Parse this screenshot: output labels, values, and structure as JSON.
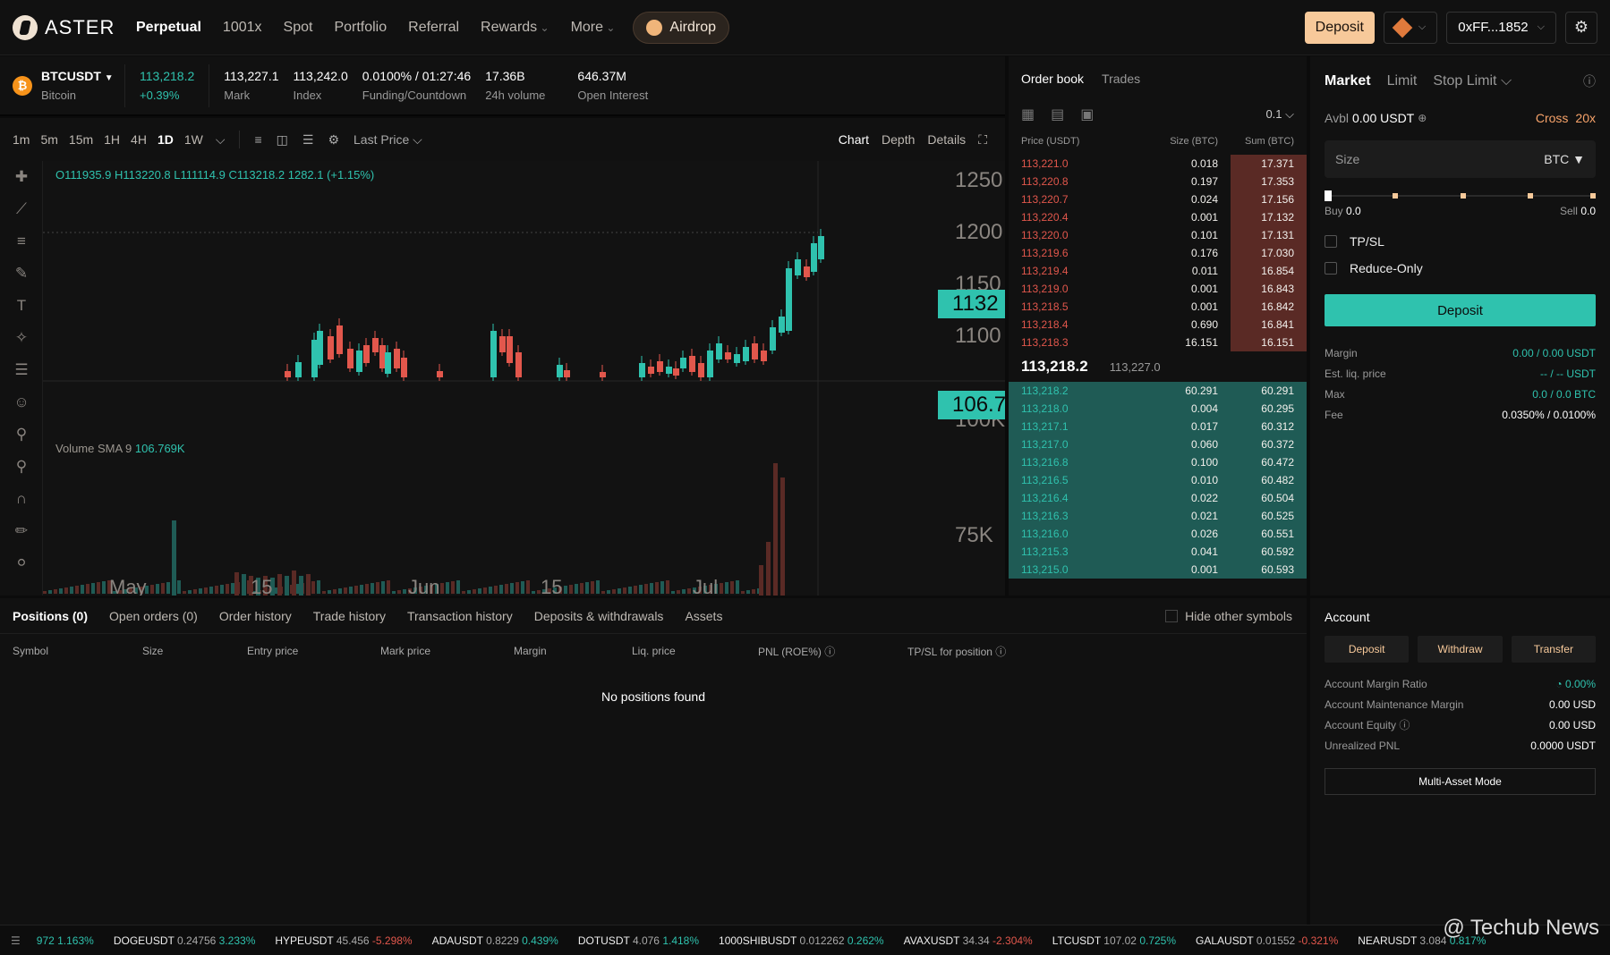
{
  "brand": {
    "name": "ASTER"
  },
  "nav": {
    "items": [
      "Perpetual",
      "1001x",
      "Spot",
      "Portfolio",
      "Referral",
      "Rewards",
      "More"
    ],
    "airdrop": "Airdrop",
    "deposit": "Deposit",
    "wallet": "0xFF...1852"
  },
  "ticker": {
    "symbol": "BTCUSDT",
    "name": "Bitcoin",
    "last": "113,218.2",
    "change": "+0.39%",
    "mark": "113,227.1",
    "mark_label": "Mark",
    "index": "113,242.0",
    "index_label": "Index",
    "funding": "0.0100% / 01:27:46",
    "funding_label": "Funding/Countdown",
    "volume": "17.36B",
    "volume_label": "24h volume",
    "oi": "646.37M",
    "oi_label": "Open Interest"
  },
  "chart_toolbar": {
    "timeframes": [
      "1m",
      "5m",
      "15m",
      "1H",
      "4H",
      "1D",
      "1W"
    ],
    "active": "1D",
    "price_type": "Last Price",
    "views": [
      "Chart",
      "Depth",
      "Details"
    ]
  },
  "chart_data": {
    "type": "candlestick",
    "ohlc": "O111935.9 H113220.8 L111114.9 C113218.2 1282.1 (+1.15%)",
    "volume_label": "Volume SMA 9",
    "volume_value": "106.769K",
    "price_axis": [
      "1250",
      "1200",
      "1150",
      "1100"
    ],
    "current_tag": "1132",
    "volume_axis": [
      "100K",
      "75K"
    ],
    "volume_tag": "106.7",
    "x_labels": [
      "May",
      "15",
      "Jun",
      "15",
      "Jul"
    ]
  },
  "orderbook": {
    "tabs": [
      "Order book",
      "Trades"
    ],
    "step": "0.1",
    "headers": [
      "Price (USDT)",
      "Size (BTC)",
      "Sum (BTC)"
    ],
    "asks": [
      [
        "113,221.0",
        "0.018",
        "17.371"
      ],
      [
        "113,220.8",
        "0.197",
        "17.353"
      ],
      [
        "113,220.7",
        "0.024",
        "17.156"
      ],
      [
        "113,220.4",
        "0.001",
        "17.132"
      ],
      [
        "113,220.0",
        "0.101",
        "17.131"
      ],
      [
        "113,219.6",
        "0.176",
        "17.030"
      ],
      [
        "113,219.4",
        "0.011",
        "16.854"
      ],
      [
        "113,219.0",
        "0.001",
        "16.843"
      ],
      [
        "113,218.5",
        "0.001",
        "16.842"
      ],
      [
        "113,218.4",
        "0.690",
        "16.841"
      ],
      [
        "113,218.3",
        "16.151",
        "16.151"
      ]
    ],
    "mid_price": "113,218.2",
    "mid_mark": "113,227.0",
    "bids": [
      [
        "113,218.2",
        "60.291",
        "60.291"
      ],
      [
        "113,218.0",
        "0.004",
        "60.295"
      ],
      [
        "113,217.1",
        "0.017",
        "60.312"
      ],
      [
        "113,217.0",
        "0.060",
        "60.372"
      ],
      [
        "113,216.8",
        "0.100",
        "60.472"
      ],
      [
        "113,216.5",
        "0.010",
        "60.482"
      ],
      [
        "113,216.4",
        "0.022",
        "60.504"
      ],
      [
        "113,216.3",
        "0.021",
        "60.525"
      ],
      [
        "113,216.0",
        "0.026",
        "60.551"
      ],
      [
        "113,215.3",
        "0.041",
        "60.592"
      ],
      [
        "113,215.0",
        "0.001",
        "60.593"
      ]
    ]
  },
  "trade": {
    "tabs": [
      "Market",
      "Limit",
      "Stop Limit"
    ],
    "avbl_label": "Avbl",
    "avbl": "0.00 USDT",
    "margin_mode": "Cross",
    "leverage": "20x",
    "size_placeholder": "Size",
    "size_unit": "BTC",
    "buy": "Buy",
    "buy_val": "0.0",
    "sell": "Sell",
    "sell_val": "0.0",
    "tpsl": "TP/SL",
    "reduce": "Reduce-Only",
    "deposit": "Deposit",
    "rows": [
      {
        "k": "Margin",
        "v": "0.00 / 0.00 USDT"
      },
      {
        "k": "Est. liq. price",
        "v": "-- / -- USDT"
      },
      {
        "k": "Max",
        "v": "0.0 / 0.0 BTC"
      },
      {
        "k": "Fee",
        "v": "0.0350% / 0.0100%"
      }
    ]
  },
  "positions": {
    "tabs": [
      "Positions (0)",
      "Open orders (0)",
      "Order history",
      "Trade history",
      "Transaction history",
      "Deposits & withdrawals",
      "Assets"
    ],
    "hide_label": "Hide other symbols",
    "columns": [
      "Symbol",
      "Size",
      "Entry price",
      "Mark price",
      "Margin",
      "Liq. price",
      "PNL (ROE%)",
      "TP/SL for position"
    ],
    "empty": "No positions found"
  },
  "account": {
    "title": "Account",
    "buttons": [
      "Deposit",
      "Withdraw",
      "Transfer"
    ],
    "rows": [
      {
        "k": "Account Margin Ratio",
        "v": "0.00%"
      },
      {
        "k": "Account Maintenance Margin",
        "v": "0.00 USD"
      },
      {
        "k": "Account Equity",
        "v": "0.00 USD"
      },
      {
        "k": "Unrealized PNL",
        "v": "0.0000 USDT"
      }
    ],
    "multi": "Multi-Asset Mode"
  },
  "footer": [
    {
      "n": "",
      "p": "",
      "c": "972 1.163%",
      "up": true
    },
    {
      "n": "DOGEUSDT",
      "p": "0.24756",
      "c": "3.233%",
      "up": true
    },
    {
      "n": "HYPEUSDT",
      "p": "45.456",
      "c": "-5.298%",
      "up": false
    },
    {
      "n": "ADAUSDT",
      "p": "0.8229",
      "c": "0.439%",
      "up": true
    },
    {
      "n": "DOTUSDT",
      "p": "4.076",
      "c": "1.418%",
      "up": true
    },
    {
      "n": "1000SHIBUSDT",
      "p": "0.012262",
      "c": "0.262%",
      "up": true
    },
    {
      "n": "AVAXUSDT",
      "p": "34.34",
      "c": "-2.304%",
      "up": false
    },
    {
      "n": "LTCUSDT",
      "p": "107.02",
      "c": "0.725%",
      "up": true
    },
    {
      "n": "GALAUSDT",
      "p": "0.01552",
      "c": "-0.321%",
      "up": false
    },
    {
      "n": "NEARUSDT",
      "p": "3.084",
      "c": "0.817%",
      "up": true
    }
  ],
  "watermark": "@ Techub News"
}
